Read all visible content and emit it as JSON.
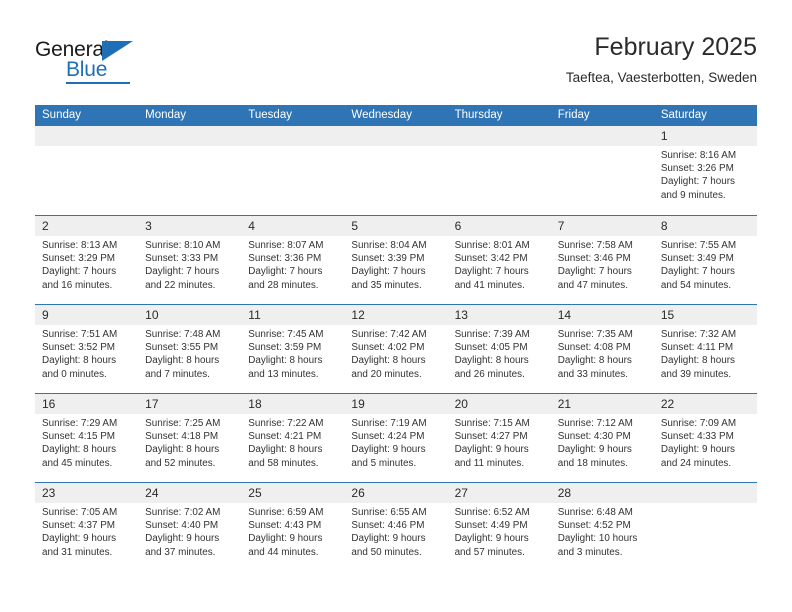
{
  "brand": {
    "name_part1": "General",
    "name_part2": "Blue",
    "logo_icon": "triangle-icon",
    "accent_color": "#1f6fb5"
  },
  "header": {
    "title": "February 2025",
    "subtitle": "Taeftea, Vaesterbotten, Sweden"
  },
  "colors": {
    "header_blue": "#2f74b5",
    "cell_head_gray": "#efefef",
    "text": "#333333"
  },
  "calendar": {
    "day_names": [
      "Sunday",
      "Monday",
      "Tuesday",
      "Wednesday",
      "Thursday",
      "Friday",
      "Saturday"
    ],
    "weeks": [
      [
        {
          "day": "",
          "lines": []
        },
        {
          "day": "",
          "lines": []
        },
        {
          "day": "",
          "lines": []
        },
        {
          "day": "",
          "lines": []
        },
        {
          "day": "",
          "lines": []
        },
        {
          "day": "",
          "lines": []
        },
        {
          "day": "1",
          "lines": [
            "Sunrise: 8:16 AM",
            "Sunset: 3:26 PM",
            "Daylight: 7 hours",
            "and 9 minutes."
          ]
        }
      ],
      [
        {
          "day": "2",
          "lines": [
            "Sunrise: 8:13 AM",
            "Sunset: 3:29 PM",
            "Daylight: 7 hours",
            "and 16 minutes."
          ]
        },
        {
          "day": "3",
          "lines": [
            "Sunrise: 8:10 AM",
            "Sunset: 3:33 PM",
            "Daylight: 7 hours",
            "and 22 minutes."
          ]
        },
        {
          "day": "4",
          "lines": [
            "Sunrise: 8:07 AM",
            "Sunset: 3:36 PM",
            "Daylight: 7 hours",
            "and 28 minutes."
          ]
        },
        {
          "day": "5",
          "lines": [
            "Sunrise: 8:04 AM",
            "Sunset: 3:39 PM",
            "Daylight: 7 hours",
            "and 35 minutes."
          ]
        },
        {
          "day": "6",
          "lines": [
            "Sunrise: 8:01 AM",
            "Sunset: 3:42 PM",
            "Daylight: 7 hours",
            "and 41 minutes."
          ]
        },
        {
          "day": "7",
          "lines": [
            "Sunrise: 7:58 AM",
            "Sunset: 3:46 PM",
            "Daylight: 7 hours",
            "and 47 minutes."
          ]
        },
        {
          "day": "8",
          "lines": [
            "Sunrise: 7:55 AM",
            "Sunset: 3:49 PM",
            "Daylight: 7 hours",
            "and 54 minutes."
          ]
        }
      ],
      [
        {
          "day": "9",
          "lines": [
            "Sunrise: 7:51 AM",
            "Sunset: 3:52 PM",
            "Daylight: 8 hours",
            "and 0 minutes."
          ]
        },
        {
          "day": "10",
          "lines": [
            "Sunrise: 7:48 AM",
            "Sunset: 3:55 PM",
            "Daylight: 8 hours",
            "and 7 minutes."
          ]
        },
        {
          "day": "11",
          "lines": [
            "Sunrise: 7:45 AM",
            "Sunset: 3:59 PM",
            "Daylight: 8 hours",
            "and 13 minutes."
          ]
        },
        {
          "day": "12",
          "lines": [
            "Sunrise: 7:42 AM",
            "Sunset: 4:02 PM",
            "Daylight: 8 hours",
            "and 20 minutes."
          ]
        },
        {
          "day": "13",
          "lines": [
            "Sunrise: 7:39 AM",
            "Sunset: 4:05 PM",
            "Daylight: 8 hours",
            "and 26 minutes."
          ]
        },
        {
          "day": "14",
          "lines": [
            "Sunrise: 7:35 AM",
            "Sunset: 4:08 PM",
            "Daylight: 8 hours",
            "and 33 minutes."
          ]
        },
        {
          "day": "15",
          "lines": [
            "Sunrise: 7:32 AM",
            "Sunset: 4:11 PM",
            "Daylight: 8 hours",
            "and 39 minutes."
          ]
        }
      ],
      [
        {
          "day": "16",
          "lines": [
            "Sunrise: 7:29 AM",
            "Sunset: 4:15 PM",
            "Daylight: 8 hours",
            "and 45 minutes."
          ]
        },
        {
          "day": "17",
          "lines": [
            "Sunrise: 7:25 AM",
            "Sunset: 4:18 PM",
            "Daylight: 8 hours",
            "and 52 minutes."
          ]
        },
        {
          "day": "18",
          "lines": [
            "Sunrise: 7:22 AM",
            "Sunset: 4:21 PM",
            "Daylight: 8 hours",
            "and 58 minutes."
          ]
        },
        {
          "day": "19",
          "lines": [
            "Sunrise: 7:19 AM",
            "Sunset: 4:24 PM",
            "Daylight: 9 hours",
            "and 5 minutes."
          ]
        },
        {
          "day": "20",
          "lines": [
            "Sunrise: 7:15 AM",
            "Sunset: 4:27 PM",
            "Daylight: 9 hours",
            "and 11 minutes."
          ]
        },
        {
          "day": "21",
          "lines": [
            "Sunrise: 7:12 AM",
            "Sunset: 4:30 PM",
            "Daylight: 9 hours",
            "and 18 minutes."
          ]
        },
        {
          "day": "22",
          "lines": [
            "Sunrise: 7:09 AM",
            "Sunset: 4:33 PM",
            "Daylight: 9 hours",
            "and 24 minutes."
          ]
        }
      ],
      [
        {
          "day": "23",
          "lines": [
            "Sunrise: 7:05 AM",
            "Sunset: 4:37 PM",
            "Daylight: 9 hours",
            "and 31 minutes."
          ]
        },
        {
          "day": "24",
          "lines": [
            "Sunrise: 7:02 AM",
            "Sunset: 4:40 PM",
            "Daylight: 9 hours",
            "and 37 minutes."
          ]
        },
        {
          "day": "25",
          "lines": [
            "Sunrise: 6:59 AM",
            "Sunset: 4:43 PM",
            "Daylight: 9 hours",
            "and 44 minutes."
          ]
        },
        {
          "day": "26",
          "lines": [
            "Sunrise: 6:55 AM",
            "Sunset: 4:46 PM",
            "Daylight: 9 hours",
            "and 50 minutes."
          ]
        },
        {
          "day": "27",
          "lines": [
            "Sunrise: 6:52 AM",
            "Sunset: 4:49 PM",
            "Daylight: 9 hours",
            "and 57 minutes."
          ]
        },
        {
          "day": "28",
          "lines": [
            "Sunrise: 6:48 AM",
            "Sunset: 4:52 PM",
            "Daylight: 10 hours",
            "and 3 minutes."
          ]
        },
        {
          "day": "",
          "lines": []
        }
      ]
    ]
  }
}
